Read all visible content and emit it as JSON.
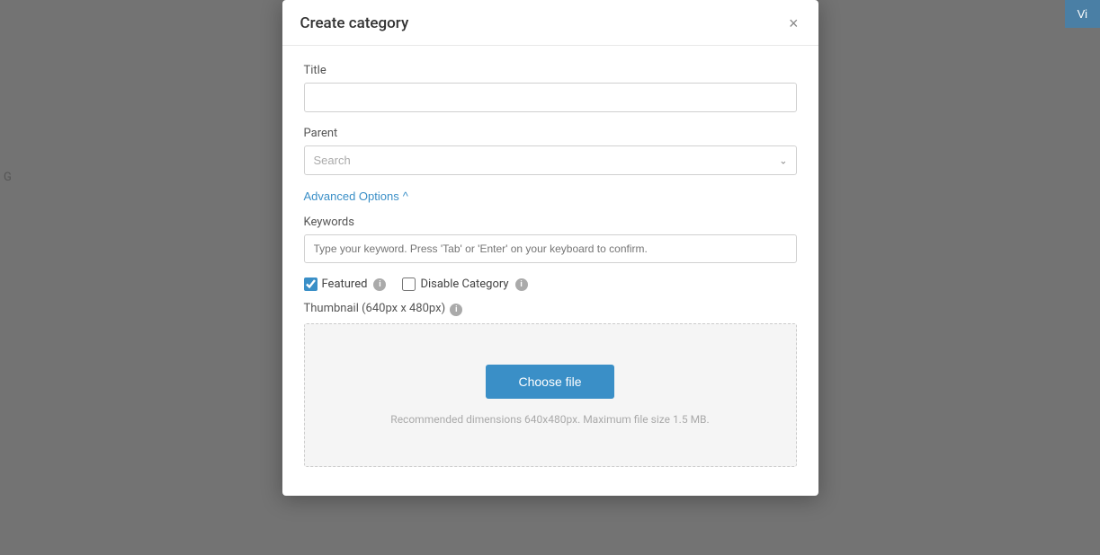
{
  "background": {
    "color": "#8a8a8a"
  },
  "top_right_button": {
    "label": "Vi"
  },
  "left_edge_text": {
    "content": "G"
  },
  "logo": {
    "color": "#c9a84c"
  },
  "modal": {
    "title": "Create category",
    "close_label": "×",
    "title_field": {
      "label": "Title",
      "value": "",
      "placeholder": ""
    },
    "parent_field": {
      "label": "Parent",
      "placeholder": "Search",
      "options": [
        "Search"
      ]
    },
    "advanced_options": {
      "label": "Advanced Options",
      "caret": "^",
      "expanded": true
    },
    "keywords_field": {
      "label": "Keywords",
      "placeholder": "Type your keyword. Press 'Tab' or 'Enter' on your keyboard to confirm.",
      "value": ""
    },
    "featured_checkbox": {
      "label": "Featured",
      "checked": true,
      "badge": "0"
    },
    "disable_category_checkbox": {
      "label": "Disable Category",
      "checked": false,
      "badge": "0"
    },
    "thumbnail_section": {
      "label": "Thumbnail (640px x 480px)",
      "choose_file_btn": "Choose file",
      "hint": "Recommended dimensions 640x480px. Maximum file size 1.5 MB."
    }
  }
}
